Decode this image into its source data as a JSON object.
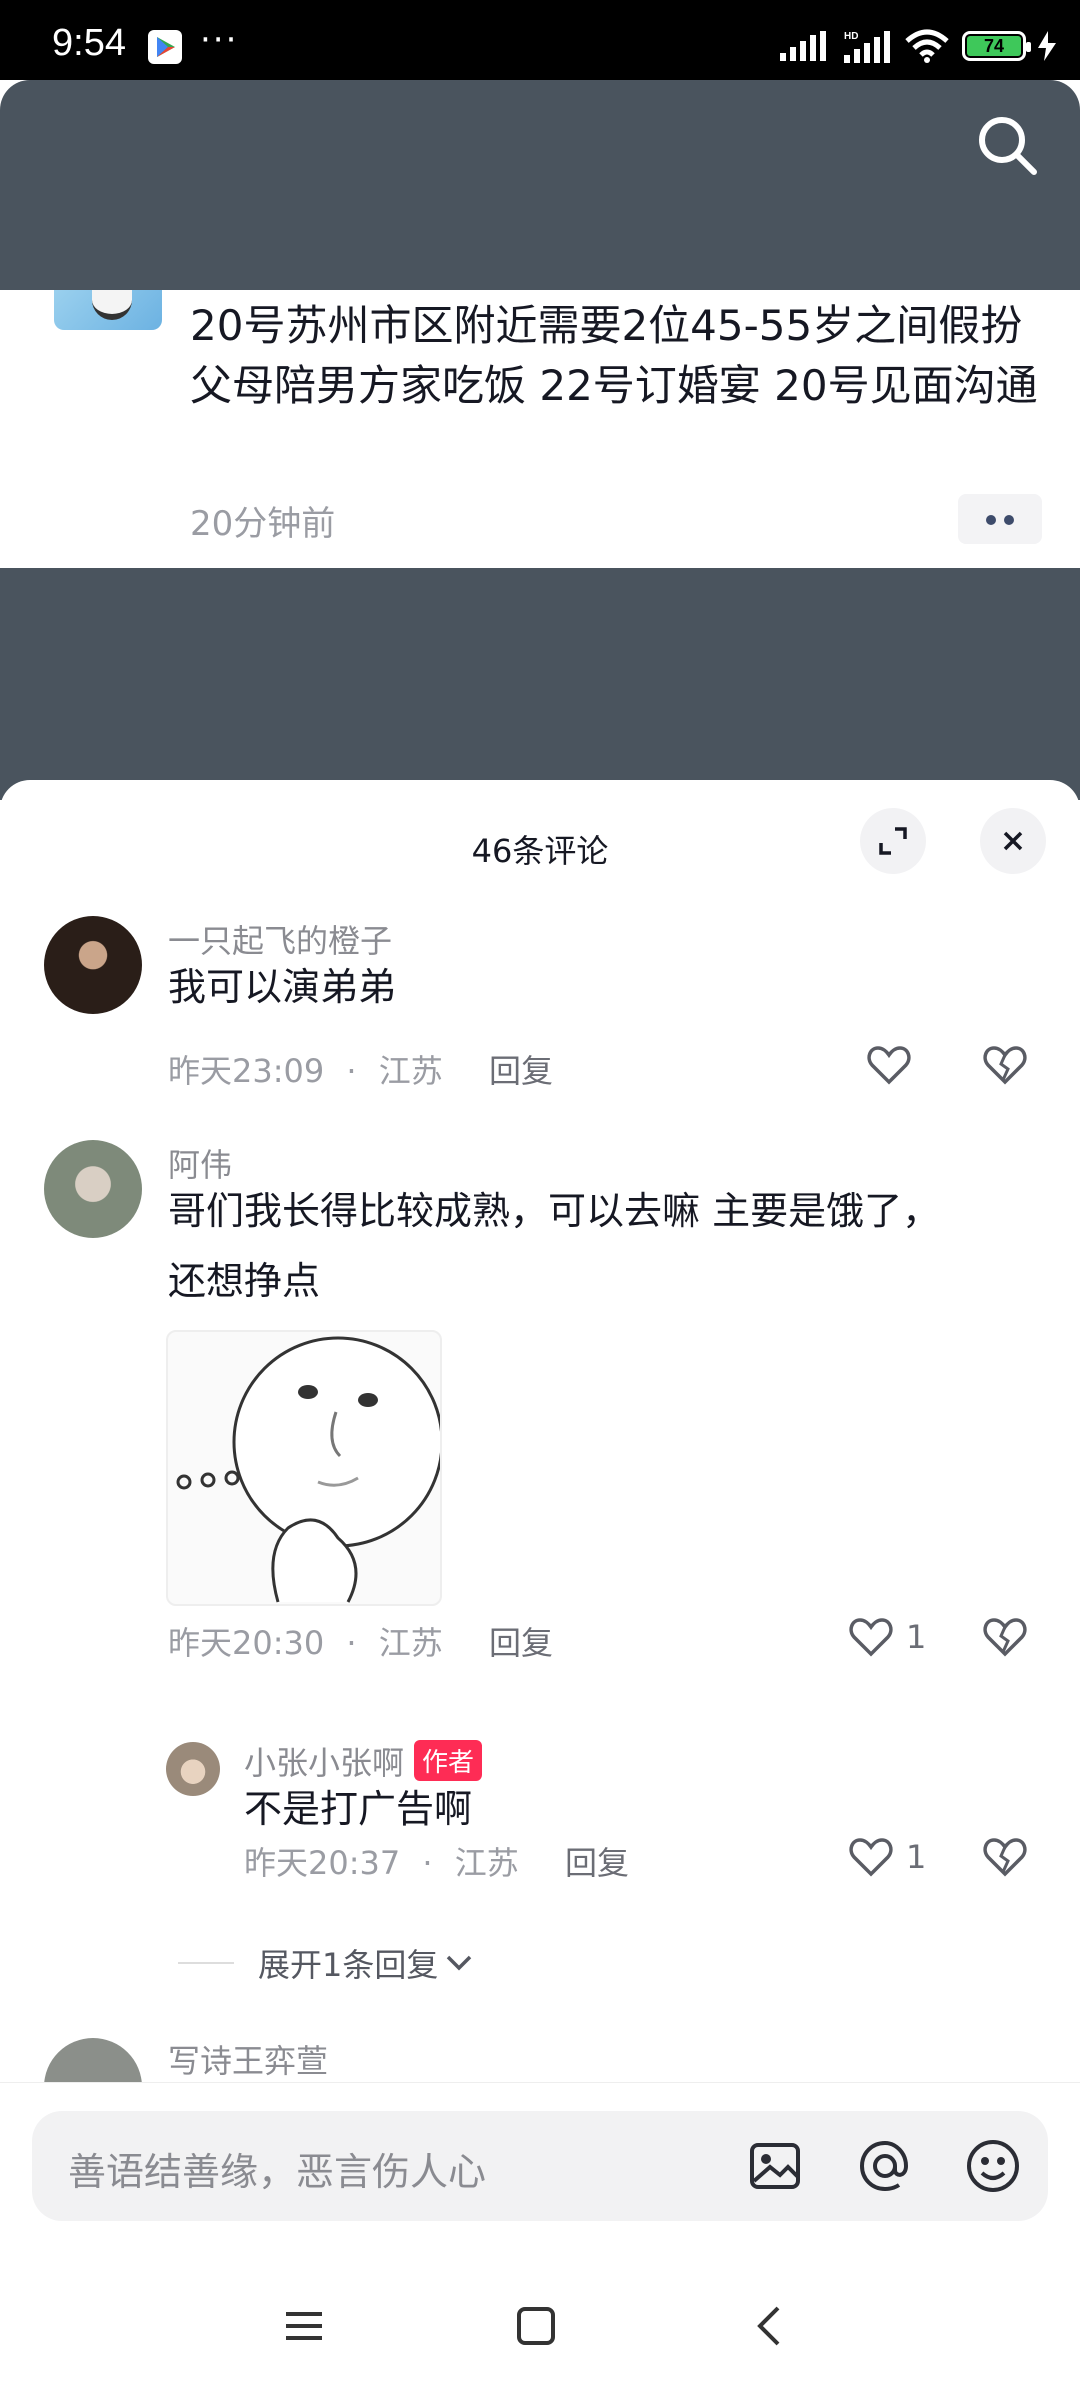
{
  "status_bar": {
    "time": "9:54",
    "overflow": "···",
    "battery": "74"
  },
  "post": {
    "text": "20号苏州市区附近需要2位45-55岁之间假扮父母陪男方家吃饭 22号订婚宴  20号见面沟通",
    "time": "20分钟前"
  },
  "sheet": {
    "title": "46条评论"
  },
  "comments": [
    {
      "user": "一只起飞的橙子",
      "text": "我可以演弟弟",
      "time": "昨天23:09",
      "location": "江苏",
      "reply": "回复"
    },
    {
      "user": "阿伟",
      "text_line1": "哥们我长得比较成熟，可以去嘛 主要是饿了，",
      "text_line2": "还想挣点",
      "time": "昨天20:30",
      "location": "江苏",
      "reply": "回复",
      "likes": "1"
    }
  ],
  "sub_reply": {
    "user": "小张小张啊",
    "badge": "作者",
    "text": "不是打广告啊",
    "time": "昨天20:37",
    "location": "江苏",
    "reply": "回复",
    "likes": "1"
  },
  "expand_label": "展开1条回复",
  "next_user": "写诗王弈萱",
  "separator": "·",
  "input": {
    "placeholder": "善语结善缘，恶言伤人心"
  }
}
